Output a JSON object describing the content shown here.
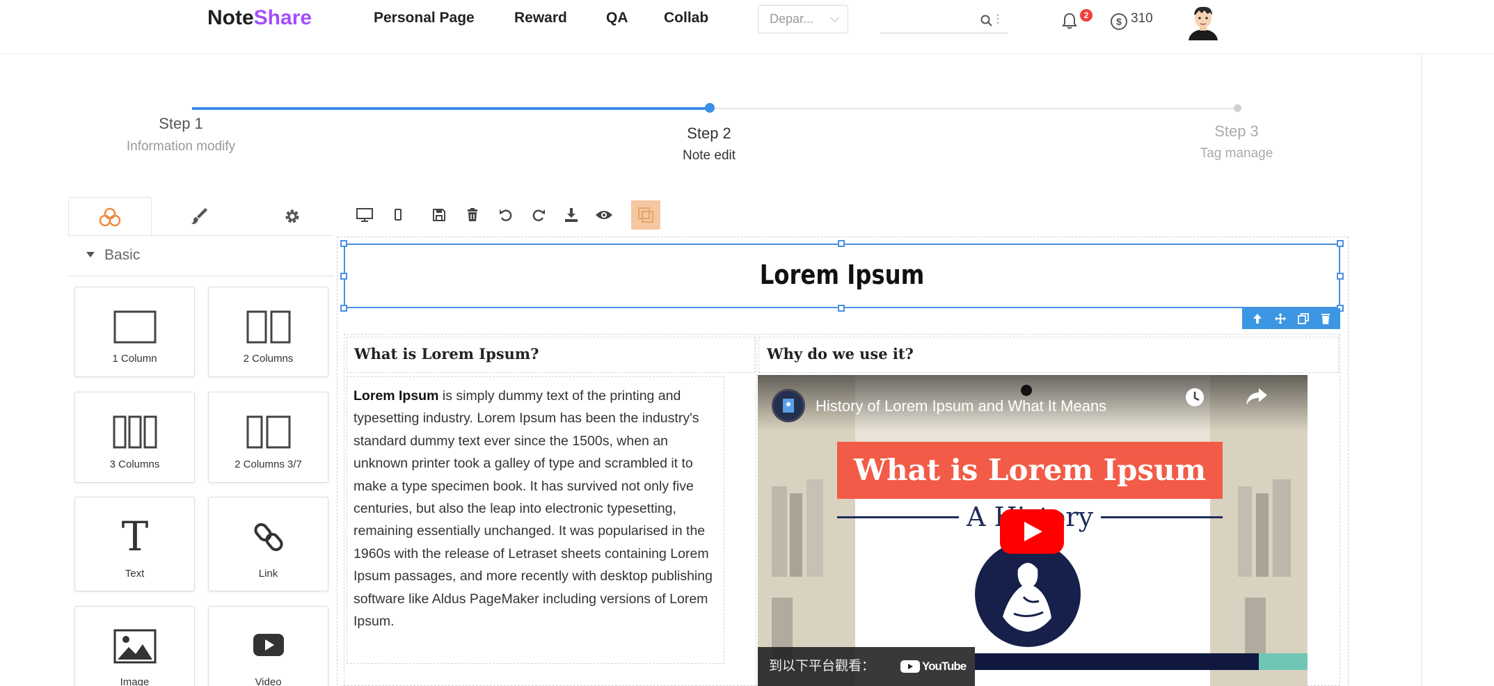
{
  "header": {
    "logo_part1": "Note",
    "logo_part2": "Share",
    "nav": [
      "Personal Page",
      "Reward",
      "QA",
      "Collab"
    ],
    "department_value": "Depar...",
    "notification_count": "2",
    "coins": "310",
    "colors": {
      "brand_accent": "#a64dff",
      "badge": "#f0403c"
    }
  },
  "steps": [
    {
      "title": "Step 1",
      "subtitle": "Information modify",
      "state": "done"
    },
    {
      "title": "Step 2",
      "subtitle": "Note edit",
      "state": "active"
    },
    {
      "title": "Step 3",
      "subtitle": "Tag manage",
      "state": "todo"
    }
  ],
  "panel": {
    "tabs": [
      {
        "icon": "blocks-icon",
        "active": true
      },
      {
        "icon": "brush-icon",
        "active": false
      },
      {
        "icon": "gear-icon",
        "active": false
      }
    ],
    "section_label": "Basic",
    "blocks": [
      "1 Column",
      "2 Columns",
      "3 Columns",
      "2 Columns 3/7",
      "Text",
      "Link",
      "Image",
      "Video"
    ]
  },
  "toolbar": {
    "icons": [
      "desktop-icon",
      "mobile-icon",
      "save-icon",
      "trash-icon",
      "undo-icon",
      "redo-icon",
      "download-icon",
      "eye-icon",
      "layers-icon"
    ],
    "active": "layers-icon"
  },
  "canvas": {
    "hero_title": "Lorem Ipsum",
    "left_heading": "What is Lorem Ipsum?",
    "right_heading": "Why do we use it?",
    "para_bold": "Lorem Ipsum",
    "para_text": " is simply dummy text of the printing and typesetting industry. Lorem Ipsum has been the industry's standard dummy text ever since the 1500s, when an unknown printer took a galley of type and scrambled it to make a type specimen book. It has survived not only five centuries, but also the leap into electronic typesetting, remaining essentially unchanged. It was popularised in the 1960s with the release of Letraset sheets containing Lorem Ipsum passages, and more recently with desktop publishing software like Aldus PageMaker including versions of Lorem Ipsum."
  },
  "video": {
    "title": "History of Lorem Ipsum and What It Means",
    "thumb_heading": "What is Lorem Ipsum",
    "thumb_sub": "A History",
    "watch_on": "到以下平台觀看：",
    "platform": "YouTube"
  }
}
